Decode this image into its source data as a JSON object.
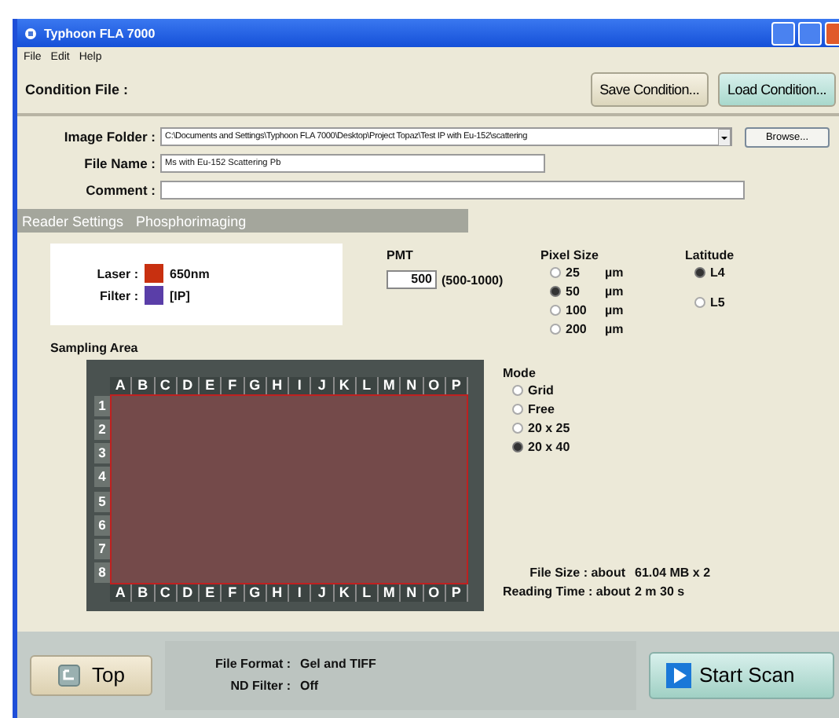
{
  "window": {
    "title": "Typhoon FLA 7000"
  },
  "menu": [
    "File",
    "Edit",
    "Help"
  ],
  "condition": {
    "label": "Condition File :",
    "buttons": [
      {
        "label": "Save Condition...",
        "kind": "plain"
      },
      {
        "label": "Load Condition...",
        "kind": "accent"
      }
    ]
  },
  "fields": [
    {
      "label": "Image Folder :",
      "value": "C:\\Documents and Settings\\Typhoon FLA 7000\\Desktop\\Project Topaz\\Test IP with Eu-152\\scattering",
      "kind": "combo"
    },
    {
      "label": "File Name :",
      "value": "Ms with Eu-152 Scattering Pb",
      "kind": "short"
    },
    {
      "label": "Comment :",
      "kind": "long"
    }
  ],
  "browse_button": "Browse...",
  "section": {
    "title": "Reader Settings",
    "mode": "Phosphorimaging"
  },
  "light": [
    {
      "label": "Laser :",
      "value": "650nm",
      "color": "#c83010"
    },
    {
      "label": "Filter :",
      "value": "[IP]",
      "color": "#5a3ea8"
    }
  ],
  "pmt": {
    "label": "PMT",
    "value": "500",
    "range": "(500-1000)"
  },
  "pixel_size": {
    "label": "Pixel Size",
    "options": [
      {
        "label": "25",
        "unit": "µm",
        "selected": false
      },
      {
        "label": "50",
        "unit": "µm",
        "selected": true
      },
      {
        "label": "100",
        "unit": "µm",
        "selected": false
      },
      {
        "label": "200",
        "unit": "µm",
        "selected": false
      }
    ]
  },
  "latitude": {
    "label": "Latitude",
    "options": [
      {
        "label": "L4",
        "selected": true
      },
      {
        "label": "L5",
        "selected": false
      }
    ]
  },
  "sampling_area": {
    "label": "Sampling Area",
    "columns_top": [
      "A",
      "B",
      "C",
      "D",
      "E",
      "F",
      "G",
      "H",
      "I",
      "J",
      "K",
      "L",
      "M",
      "N",
      "O",
      "P"
    ],
    "columns_bottom": [
      "A",
      "B",
      "C",
      "D",
      "E",
      "F",
      "G",
      "H",
      "I",
      "J",
      "K",
      "L",
      "M",
      "N",
      "O",
      "P"
    ],
    "rows": [
      "1",
      "2",
      "3",
      "4",
      "5",
      "6",
      "7",
      "8"
    ]
  },
  "mode": {
    "label": "Mode",
    "options": [
      {
        "label": "Grid",
        "selected": false
      },
      {
        "label": "Free",
        "selected": false
      },
      {
        "label": "20 x 25",
        "selected": false
      },
      {
        "label": "20 x 40",
        "selected": true
      }
    ]
  },
  "estimates": [
    {
      "label": "File Size : about",
      "value": "61.04 MB x 2"
    },
    {
      "label": "Reading Time : about",
      "value": "2 m 30 s"
    }
  ],
  "footer": {
    "top_button": "Top",
    "info": [
      {
        "label": "File Format :",
        "value": "Gel and TIFF"
      },
      {
        "label": "ND Filter :",
        "value": "Off"
      }
    ],
    "start_button": "Start Scan"
  }
}
